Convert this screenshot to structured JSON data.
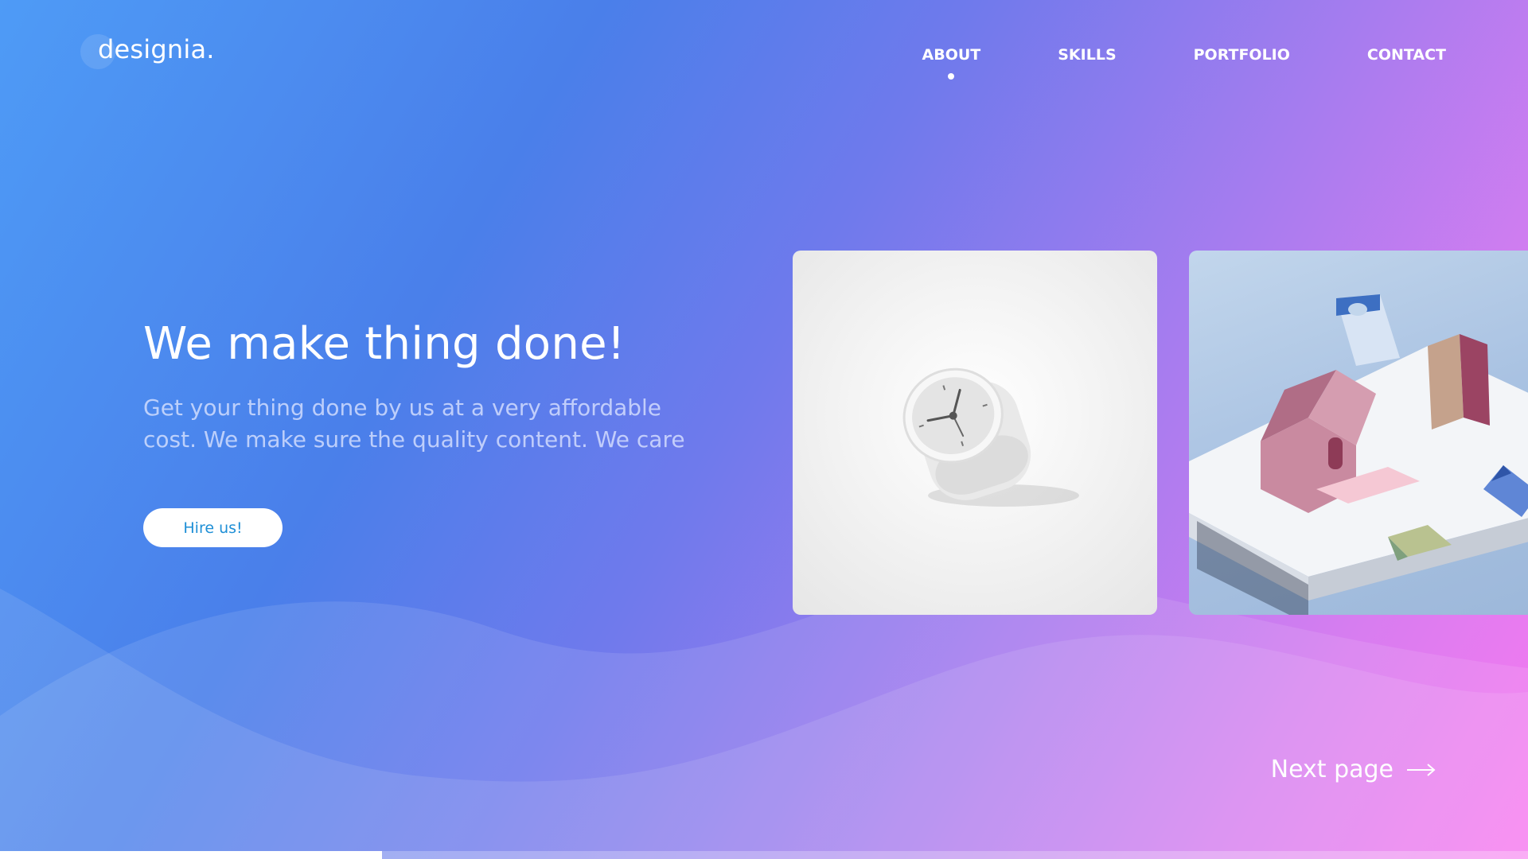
{
  "brand": {
    "logo_text": "designia."
  },
  "nav": {
    "items": [
      {
        "label": "ABOUT",
        "active": true
      },
      {
        "label": "SKILLS",
        "active": false
      },
      {
        "label": "PORTFOLIO",
        "active": false
      },
      {
        "label": "CONTACT",
        "active": false
      }
    ]
  },
  "hero": {
    "headline": "We make thing done!",
    "subtext": "Get your thing done by us at a very affordable cost. We make sure the quality content. We care",
    "cta_label": "Hire us!"
  },
  "gallery": {
    "cards": [
      {
        "image": "desk-clock-icon"
      },
      {
        "image": "paper-houses-icon"
      }
    ]
  },
  "pager": {
    "next_label": "Next page",
    "progress_fraction": 0.25
  },
  "colors": {
    "gradient_start": "#4e9bf6",
    "gradient_mid": "#4a7fea",
    "gradient_end": "#f879f0",
    "button_text": "#1e8fd6"
  }
}
